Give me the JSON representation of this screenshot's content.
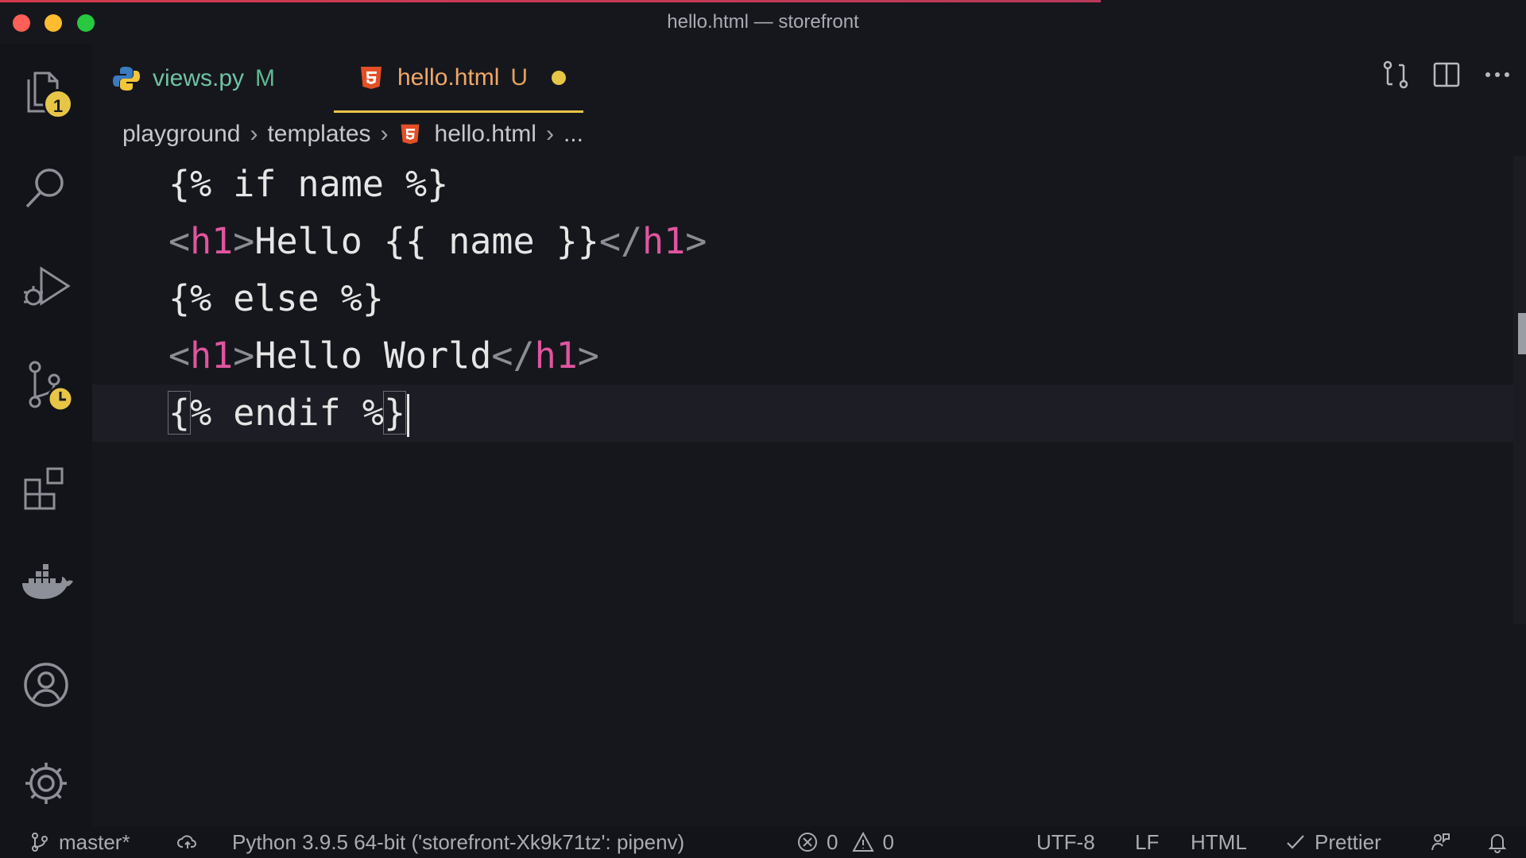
{
  "window": {
    "title": "hello.html — storefront"
  },
  "activity_bar": {
    "explorer_badge": "1"
  },
  "tabs": [
    {
      "label": "views.py",
      "status": "M"
    },
    {
      "label": "hello.html",
      "status": "U"
    }
  ],
  "breadcrumb": {
    "items": [
      "playground",
      "templates",
      "hello.html",
      "..."
    ]
  },
  "editor": {
    "lines": [
      "{% if name %}",
      "<h1>Hello {{ name }}</h1>",
      "{% else %}",
      "<h1>Hello World</h1>",
      "{% endif %}"
    ]
  },
  "status_bar": {
    "branch": "master*",
    "interpreter": "Python 3.9.5 64-bit ('storefront-Xk9k71tz': pipenv)",
    "errors": "0",
    "warnings": "0",
    "encoding": "UTF-8",
    "eol": "LF",
    "language": "HTML",
    "formatter": "Prettier"
  },
  "colors": {
    "tab_active_border": "#e7c547",
    "tag_name": "#e0559f",
    "badge": "#e7c547"
  }
}
